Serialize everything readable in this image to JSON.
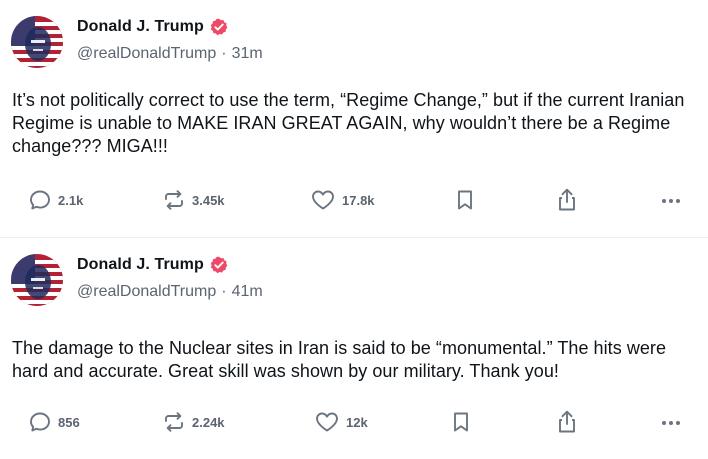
{
  "colors": {
    "verified_badge": "#ee4967",
    "action_icon": "#6b7580",
    "divider": "#eceff1"
  },
  "posts": [
    {
      "display_name": "Donald J. Trump",
      "handle": "@realDonaldTrump",
      "separator": "·",
      "time": "31m",
      "text": "It’s not politically correct to use the term, “Regime Change,” but if the current Iranian Regime is unable to MAKE IRAN GREAT AGAIN, why wouldn’t there be a Regime change??? MIGA!!!",
      "replies": "2.1k",
      "reposts": "3.45k",
      "likes": "17.8k",
      "icons": [
        "reply-icon",
        "repost-icon",
        "like-icon",
        "bookmark-icon",
        "share-icon",
        "more-icon"
      ]
    },
    {
      "display_name": "Donald J. Trump",
      "handle": "@realDonaldTrump",
      "separator": "·",
      "time": "41m",
      "text": "The damage to the Nuclear sites in Iran is said to be “monumental.” The hits were hard and accurate. Great skill was shown by our military. Thank you!",
      "replies": "856",
      "reposts": "2.24k",
      "likes": "12k",
      "icons": [
        "reply-icon",
        "repost-icon",
        "like-icon",
        "bookmark-icon",
        "share-icon",
        "more-icon"
      ]
    }
  ]
}
